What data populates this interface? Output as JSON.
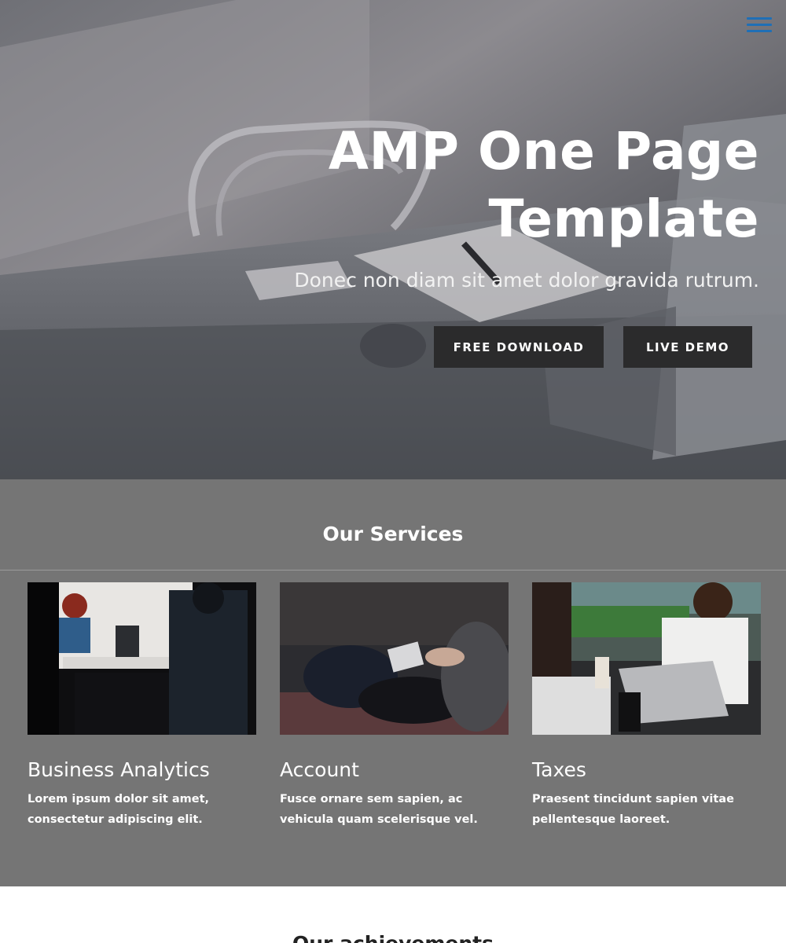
{
  "hero": {
    "title_line1": "AMP One Page",
    "title_line2": "Template",
    "subtitle": "Donec non diam sit amet dolor gravida rutrum.",
    "download_label": "FREE DOWNLOAD",
    "demo_label": "LIVE DEMO",
    "menu_icon": "hamburger-menu-icon"
  },
  "services": {
    "heading": "Our Services",
    "cards": [
      {
        "title": "Business Analytics",
        "text": "Lorem ipsum dolor sit amet, consectetur adipiscing elit."
      },
      {
        "title": "Account",
        "text": "Fusce ornare sem sapien, ac vehicula quam scelerisque vel."
      },
      {
        "title": "Taxes",
        "text": "Praesent tincidunt sapien vitae pellentesque laoreet."
      }
    ]
  },
  "achievements": {
    "heading": "Our achievements"
  },
  "colors": {
    "button_bg": "#2b2b2c",
    "services_bg": "#757575",
    "menu_icon": "#1f6fb6"
  }
}
